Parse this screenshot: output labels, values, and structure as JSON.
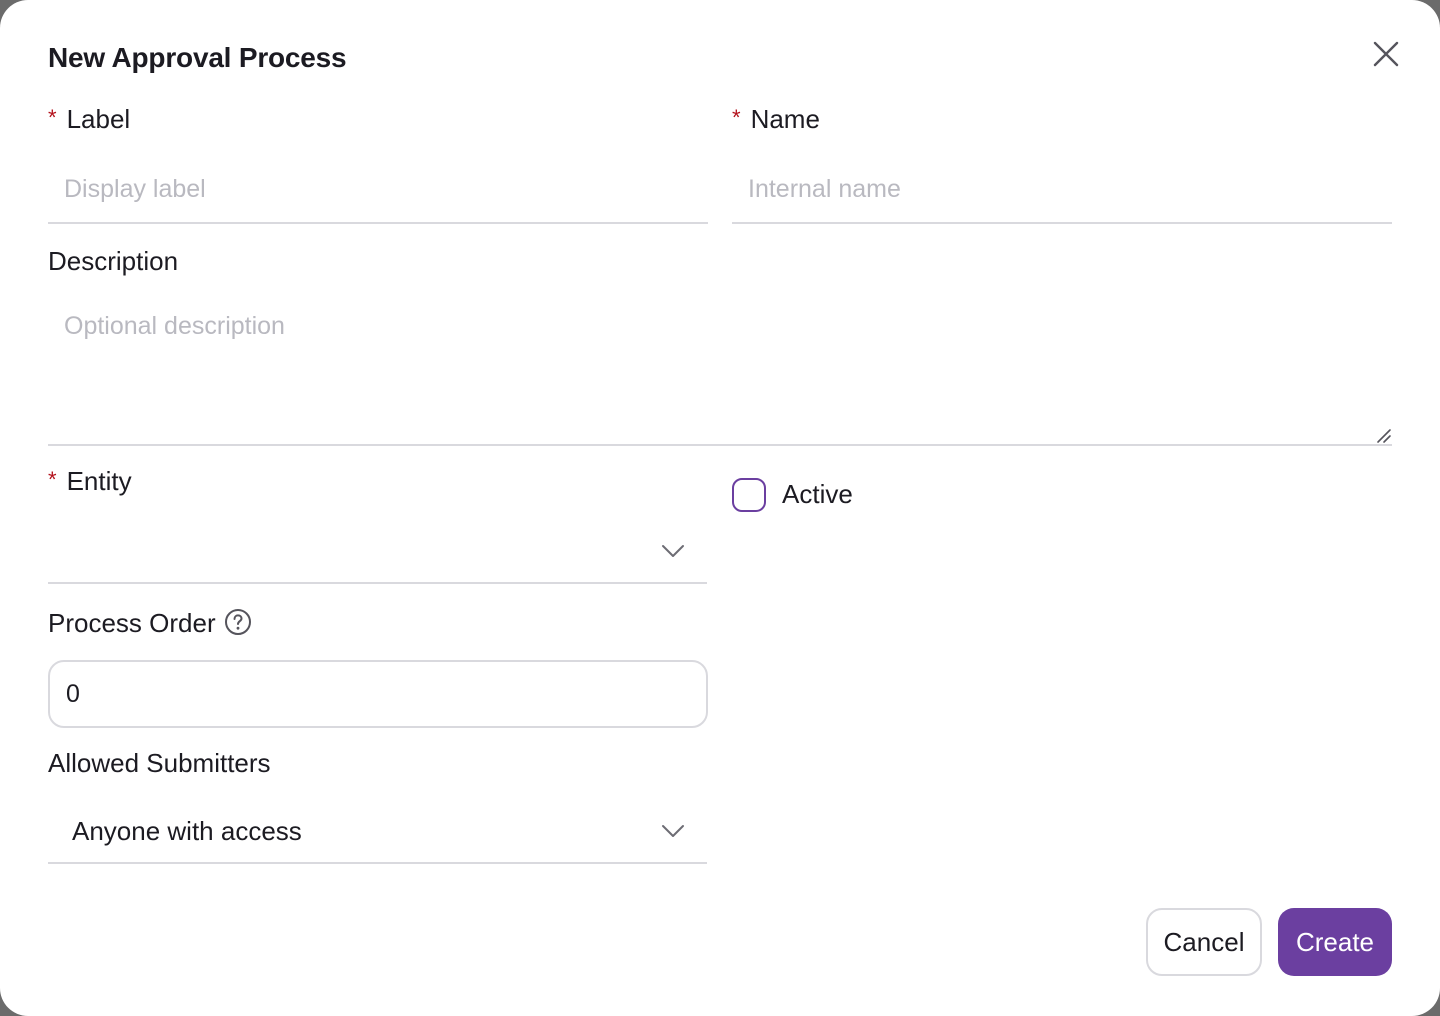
{
  "dialog": {
    "title": "New Approval Process",
    "close_icon": "close-icon"
  },
  "fields": {
    "label": {
      "label": "Label",
      "required_mark": "*",
      "placeholder": "Display label",
      "value": ""
    },
    "name": {
      "label": "Name",
      "required_mark": "*",
      "placeholder": "Internal name",
      "value": ""
    },
    "description": {
      "label": "Description",
      "placeholder": "Optional description",
      "value": ""
    },
    "entity": {
      "label": "Entity",
      "required_mark": "*",
      "value": "",
      "icon": "chevron-down-icon"
    },
    "active": {
      "label": "Active",
      "checked": false
    },
    "process_order": {
      "label": "Process Order",
      "help_icon": "help-icon",
      "value": "0"
    },
    "allowed_submitters": {
      "label": "Allowed Submitters",
      "value": "Anyone with access",
      "icon": "chevron-down-icon"
    }
  },
  "actions": {
    "cancel_label": "Cancel",
    "create_label": "Create"
  },
  "colors": {
    "accent": "#6b3fa0",
    "required": "#b3121c",
    "border": "#d9d9de",
    "placeholder": "#b9b9c0",
    "text": "#1c1b22"
  }
}
